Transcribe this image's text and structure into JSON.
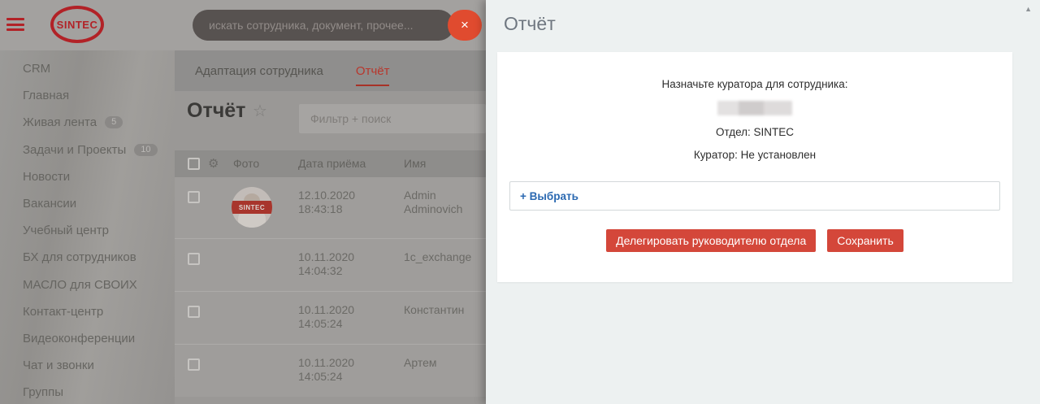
{
  "topbar": {
    "logo_text": "SINTEC",
    "search_placeholder": "искать сотрудника, документ, прочее...",
    "close_icon": "×"
  },
  "sidebar": {
    "items": [
      {
        "label": "CRM"
      },
      {
        "label": "Главная"
      },
      {
        "label": "Живая лента",
        "badge": "5"
      },
      {
        "label": "Задачи и Проекты",
        "badge": "10"
      },
      {
        "label": "Новости"
      },
      {
        "label": "Вакансии"
      },
      {
        "label": "Учебный центр"
      },
      {
        "label": "БХ для сотрудников"
      },
      {
        "label": "МАСЛО для СВОИХ"
      },
      {
        "label": "Контакт-центр"
      },
      {
        "label": "Видеоконференции"
      },
      {
        "label": "Чат и звонки"
      },
      {
        "label": "Группы"
      }
    ]
  },
  "tabs": {
    "adaptation": "Адаптация сотрудника",
    "report": "Отчёт"
  },
  "grid": {
    "title": "Отчёт",
    "star_icon": "☆",
    "gear_icon": "⚙",
    "filter_placeholder": "Фильтр + поиск",
    "columns": {
      "photo": "Фото",
      "date": "Дата приёма",
      "name": "Имя"
    },
    "rows": [
      {
        "date": "12.10.2020",
        "time": "18:43:18",
        "name": "Admin Adminovich",
        "avatar_text": "SINTEC"
      },
      {
        "date": "10.11.2020",
        "time": "14:04:32",
        "name": "1c_exchange"
      },
      {
        "date": "10.11.2020",
        "time": "14:05:24",
        "name": "Константин"
      },
      {
        "date": "10.11.2020",
        "time": "14:05:24",
        "name": "Артем"
      }
    ]
  },
  "panel": {
    "title": "Отчёт",
    "scroll_up_icon": "▲",
    "heading": "Назначьте куратора для сотрудника:",
    "department": "Отдел: SINTEC",
    "curator": "Куратор: Не установлен",
    "select_label": "+ Выбрать",
    "delegate_button": "Делегировать руководителю отдела",
    "save_button": "Сохранить"
  },
  "colors": {
    "accent_red": "#d4473a",
    "brand_red": "#b22227",
    "link_blue": "#2b69b1",
    "panel_bg": "#edf1f1"
  }
}
